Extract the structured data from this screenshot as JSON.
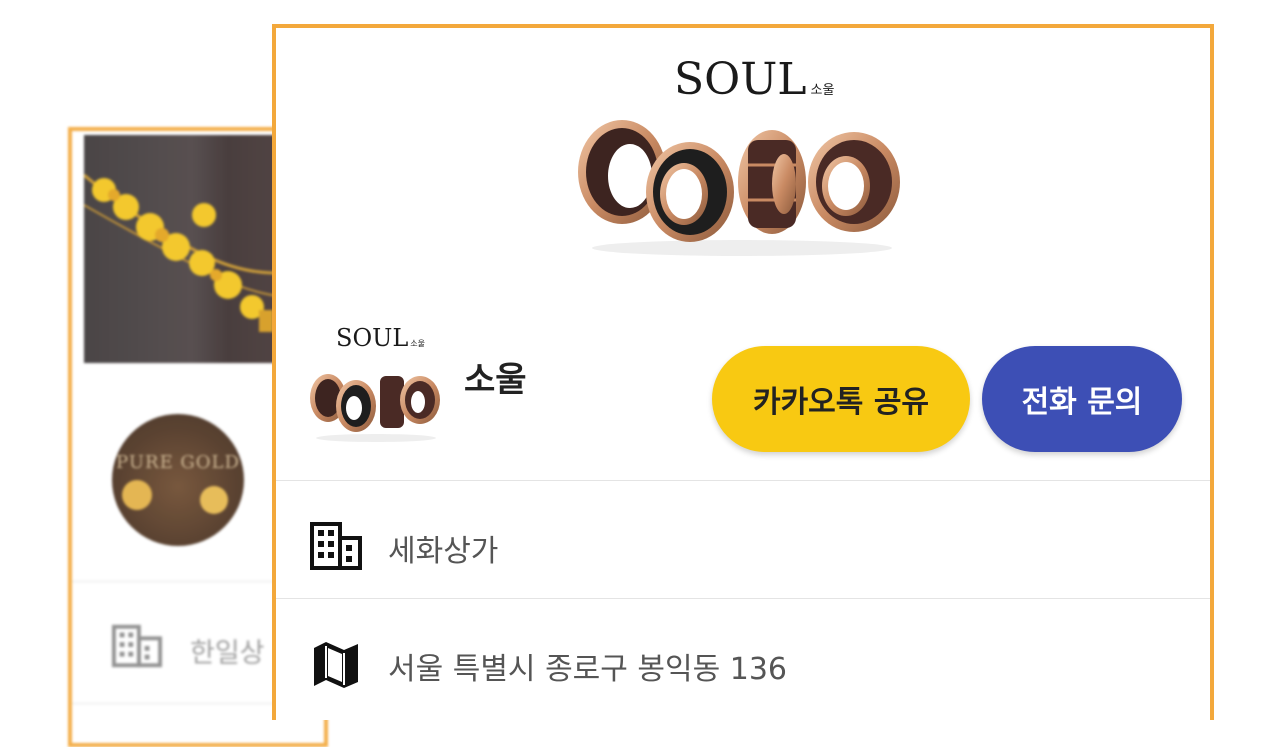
{
  "background_card": {
    "photo_alt": "gold-bead-necklace",
    "avatar_text": "PURE GOLD",
    "row_label": "한일상"
  },
  "store_card": {
    "banner": {
      "logo": "SOUL",
      "logo_sub": "소울"
    },
    "avatar": {
      "logo": "SOUL",
      "logo_sub": "소울"
    },
    "store_name": "소울",
    "buttons": {
      "kakao_share": "카카오톡 공유",
      "phone_inquiry": "전화 문의"
    },
    "info": {
      "building_label": "세화상가",
      "address_label": "서울 특별시 종로구 봉익동 136"
    }
  },
  "colors": {
    "card_border": "#f3a83b",
    "kakao_button": "#f8c912",
    "call_button": "#3d4fb5"
  },
  "icons": [
    "building-icon",
    "map-icon"
  ]
}
